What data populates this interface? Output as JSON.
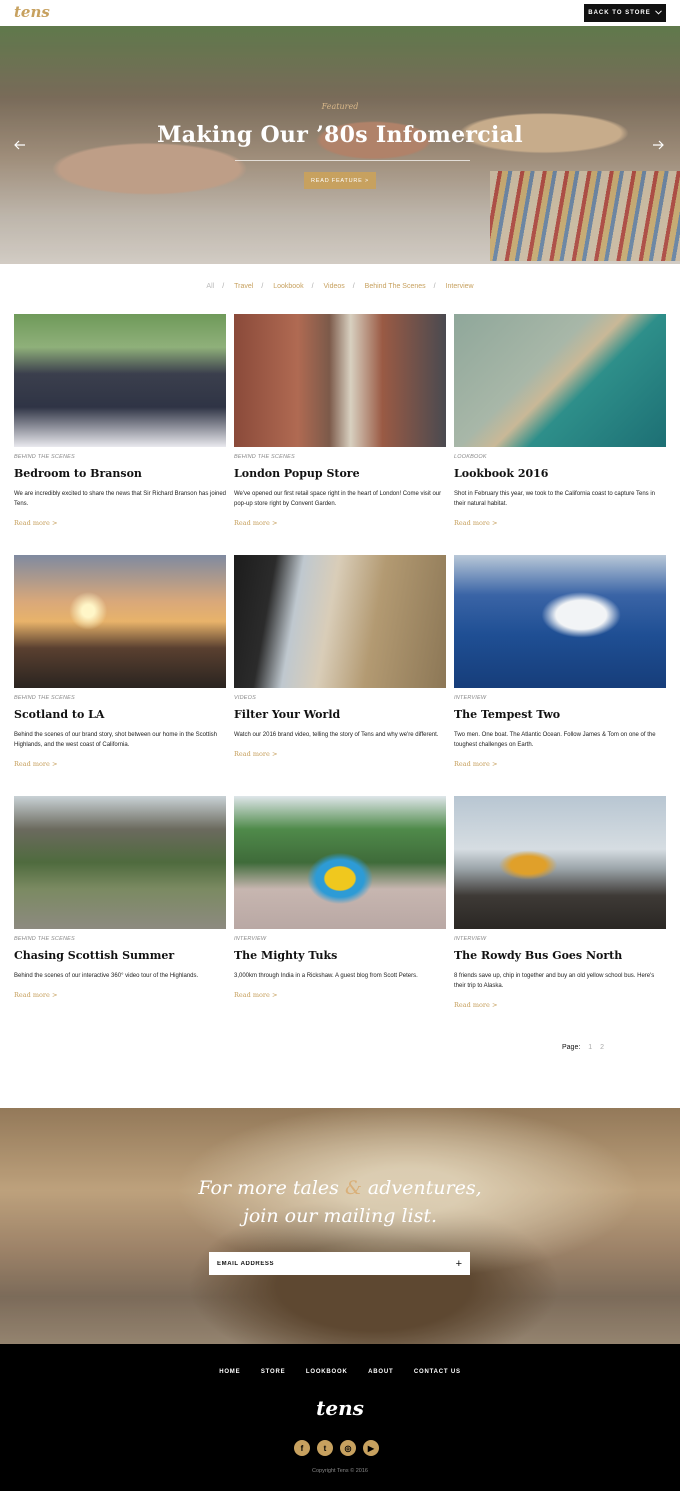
{
  "header": {
    "logo": "tens",
    "back_label": "BACK TO STORE",
    "back_icon": "chevron-down"
  },
  "hero": {
    "kicker": "Featured",
    "title": "Making Our ’80s Infomercial",
    "button": "READ FEATURE >",
    "prev_icon": "arrow-left",
    "next_icon": "arrow-right"
  },
  "filters": [
    "All",
    "Travel",
    "Lookbook",
    "Videos",
    "Behind The Scenes",
    "Interview"
  ],
  "cards": [
    {
      "category": "BEHIND THE SCENES",
      "title": "Bedroom to Branson",
      "desc": "We are incredibly excited to share the news that Sir Richard Branson has joined Tens.",
      "more": "Read more >"
    },
    {
      "category": "BEHIND THE SCENES",
      "title": "London Popup Store",
      "desc": "We've opened our first retail space right in the heart of London! Come visit our pop-up store right by Convent Garden.",
      "more": "Read more >"
    },
    {
      "category": "LOOKBOOK",
      "title": "Lookbook 2016",
      "desc": "Shot in February this year, we took to the California coast to capture Tens in their natural habitat.",
      "more": "Read more >"
    },
    {
      "category": "BEHIND THE SCENES",
      "title": "Scotland to LA",
      "desc": "Behind the scenes of our brand story, shot between our home in the Scottish Highlands, and the west coast of California.",
      "more": "Read more >"
    },
    {
      "category": "VIDEOS",
      "title": "Filter Your World",
      "desc": "Watch our 2016 brand video, telling the story of Tens and why we're different.",
      "more": "Read more >"
    },
    {
      "category": "INTERVIEW",
      "title": "The Tempest Two",
      "desc": "Two men. One boat. The Atlantic Ocean. Follow James & Tom on one of the toughest challenges on Earth.",
      "more": "Read more >"
    },
    {
      "category": "BEHIND THE SCENES",
      "title": "Chasing Scottish Summer",
      "desc": "Behind the scenes of our interactive 360° video tour of the Highlands.",
      "more": "Read more >"
    },
    {
      "category": "INTERVIEW",
      "title": "The Mighty Tuks",
      "desc": "3,000km through India in a Rickshaw. A guest blog from Scott Peters.",
      "more": "Read more >"
    },
    {
      "category": "INTERVIEW",
      "title": "The Rowdy Bus Goes North",
      "desc": "8 friends save up, chip in together and buy an old yellow school bus. Here's their trip to Alaska.",
      "more": "Read more >"
    }
  ],
  "pager": {
    "label": "Page:",
    "pages": [
      "1",
      "2"
    ]
  },
  "mailing": {
    "line1_a": "For more tales ",
    "amp": "&",
    "line1_b": " adventures,",
    "line2": "join our mailing list.",
    "placeholder": "EMAIL ADDRESS",
    "submit": "+"
  },
  "footer": {
    "nav": [
      "HOME",
      "STORE",
      "LOOKBOOK",
      "ABOUT",
      "CONTACT US"
    ],
    "logo": "tens",
    "social": [
      "f",
      "t",
      "◎",
      "▶"
    ],
    "social_icons": [
      "facebook-icon",
      "twitter-icon",
      "instagram-icon",
      "youtube-icon"
    ],
    "copyright": "Copyright Tens © 2016"
  },
  "colors": {
    "accent": "#c7a15f",
    "dark": "#111111"
  }
}
